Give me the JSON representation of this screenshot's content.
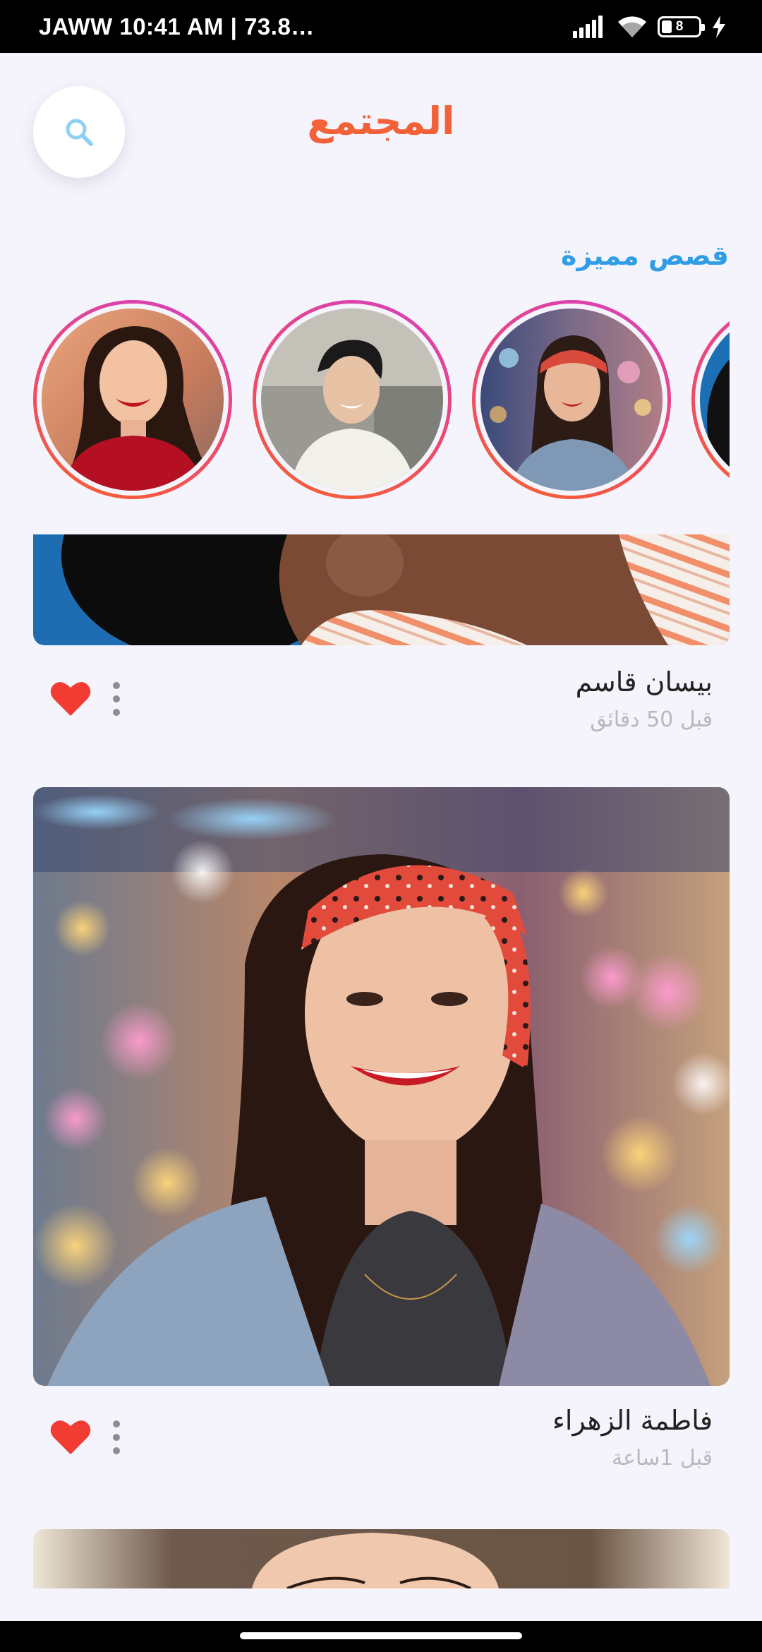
{
  "status_bar": {
    "carrier": "JAWW",
    "time_info": "10:41 AM | 73.8…",
    "battery_level": "8",
    "icons": [
      "signal-icon",
      "wifi-icon",
      "battery-icon",
      "charging-icon"
    ]
  },
  "header": {
    "title": "المجتمع",
    "search_icon": "search-icon"
  },
  "stories": {
    "title": "قصص مميزة",
    "items": [
      "story-woman-red-sweater",
      "story-man-white-shirt",
      "story-woman-bandana",
      "story-partial"
    ]
  },
  "posts": [
    {
      "author": "بيسان قاسم",
      "time": "قبل 50 دقائق",
      "liked": true
    },
    {
      "author": "فاطمة الزهراء",
      "time": "قبل 1ساعة",
      "liked": true
    }
  ],
  "colors": {
    "title": "#f26138",
    "section_title": "#2f9ee6",
    "like": "#f23b32",
    "background": "#f5f3fb"
  }
}
